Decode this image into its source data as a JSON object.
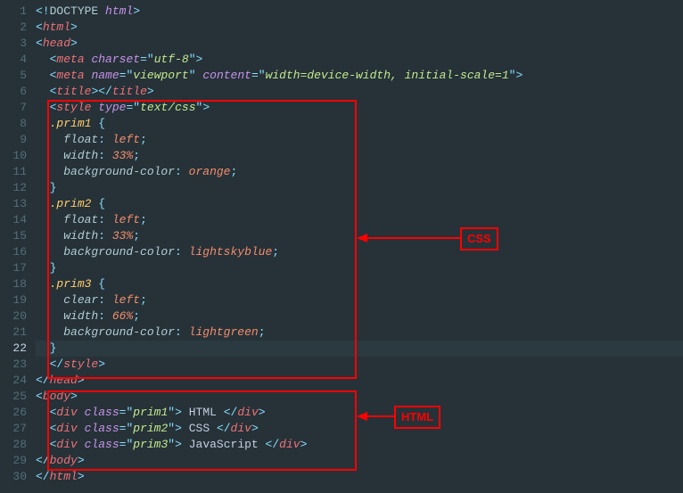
{
  "annotations": {
    "css_label": "CSS",
    "html_label": "HTML"
  },
  "code": {
    "lines": [
      {
        "n": 1,
        "indent": 0,
        "t": "open-doctype",
        "doctype_kw": "<!DOCTYPE",
        "doctype_val": "html",
        "close": ">"
      },
      {
        "n": 2,
        "indent": 0,
        "t": "open-tag",
        "name": "html"
      },
      {
        "n": 3,
        "indent": 0,
        "t": "open-tag",
        "name": "head"
      },
      {
        "n": 4,
        "indent": 1,
        "t": "self-tag",
        "name": "meta",
        "attrs": [
          [
            "charset",
            "utf-8"
          ]
        ]
      },
      {
        "n": 5,
        "indent": 1,
        "t": "self-tag",
        "name": "meta",
        "attrs": [
          [
            "name",
            "viewport"
          ],
          [
            "content",
            "width=device-width, initial-scale=1"
          ]
        ]
      },
      {
        "n": 6,
        "indent": 1,
        "t": "pair-tag",
        "name": "title",
        "inner": ""
      },
      {
        "n": 7,
        "indent": 1,
        "t": "open-tag",
        "name": "style",
        "attrs": [
          [
            "type",
            "text/css"
          ]
        ]
      },
      {
        "n": 8,
        "indent": 1,
        "t": "css-sel",
        "sel": ".prim1",
        "brace": "{"
      },
      {
        "n": 9,
        "indent": 2,
        "t": "css-decl",
        "prop": "float",
        "val": "left"
      },
      {
        "n": 10,
        "indent": 2,
        "t": "css-decl",
        "prop": "width",
        "val": "33%"
      },
      {
        "n": 11,
        "indent": 2,
        "t": "css-decl",
        "prop": "background-color",
        "val": "orange"
      },
      {
        "n": 12,
        "indent": 1,
        "t": "css-close"
      },
      {
        "n": 13,
        "indent": 1,
        "t": "css-sel",
        "sel": ".prim2",
        "brace": "{"
      },
      {
        "n": 14,
        "indent": 2,
        "t": "css-decl",
        "prop": "float",
        "val": "left"
      },
      {
        "n": 15,
        "indent": 2,
        "t": "css-decl",
        "prop": "width",
        "val": "33%"
      },
      {
        "n": 16,
        "indent": 2,
        "t": "css-decl",
        "prop": "background-color",
        "val": "lightskyblue"
      },
      {
        "n": 17,
        "indent": 1,
        "t": "css-close"
      },
      {
        "n": 18,
        "indent": 1,
        "t": "css-sel",
        "sel": ".prim3",
        "brace": "{"
      },
      {
        "n": 19,
        "indent": 2,
        "t": "css-decl",
        "prop": "clear",
        "val": "left"
      },
      {
        "n": 20,
        "indent": 2,
        "t": "css-decl",
        "prop": "width",
        "val": "66%"
      },
      {
        "n": 21,
        "indent": 2,
        "t": "css-decl",
        "prop": "background-color",
        "val": "lightgreen"
      },
      {
        "n": 22,
        "indent": 1,
        "t": "css-close",
        "active": true
      },
      {
        "n": 23,
        "indent": 1,
        "t": "close-tag",
        "name": "style"
      },
      {
        "n": 24,
        "indent": 0,
        "t": "close-tag",
        "name": "head"
      },
      {
        "n": 25,
        "indent": 0,
        "t": "open-tag",
        "name": "body"
      },
      {
        "n": 26,
        "indent": 1,
        "t": "div-line",
        "cls": "prim1",
        "text": " HTML "
      },
      {
        "n": 27,
        "indent": 1,
        "t": "div-line",
        "cls": "prim2",
        "text": " CSS "
      },
      {
        "n": 28,
        "indent": 1,
        "t": "div-line",
        "cls": "prim3",
        "text": " JavaScript "
      },
      {
        "n": 29,
        "indent": 0,
        "t": "close-tag",
        "name": "body"
      },
      {
        "n": 30,
        "indent": 0,
        "t": "close-tag",
        "name": "html"
      }
    ]
  }
}
